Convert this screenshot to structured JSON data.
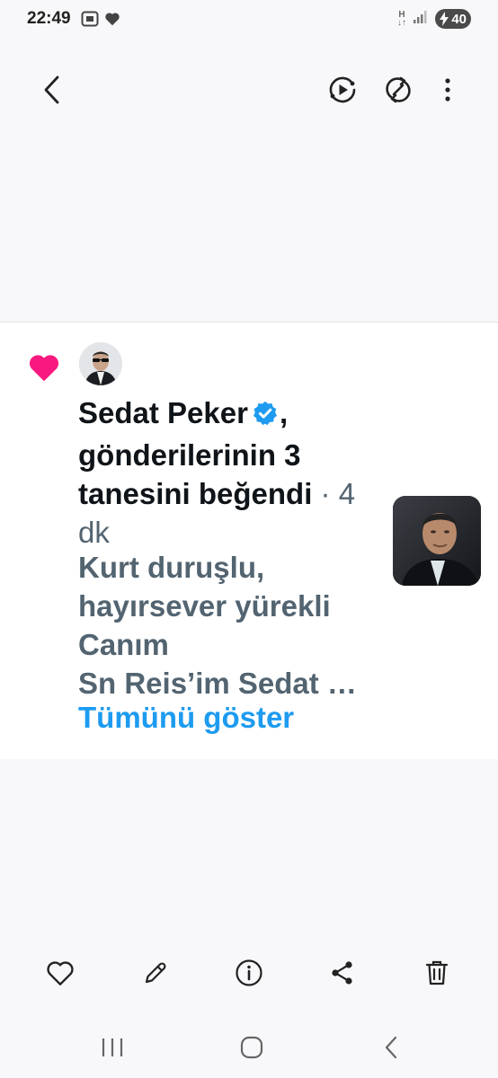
{
  "status_bar": {
    "time": "22:49",
    "network_type": "H",
    "battery_level": "40"
  },
  "toolbar": {
    "back_icon": "chevron-left-icon",
    "play_icon": "play-circle-icon",
    "sync_icon": "sync-icon",
    "more_icon": "more-vertical-icon"
  },
  "notification": {
    "badge_icon": "heart-icon",
    "user_name": "Sedat Peker",
    "verified_icon": "verified-badge-icon",
    "comma": ",",
    "action_text": "gönderilerinin 3 tanesini beğendi",
    "time_ago": " · 4 dk",
    "preview_lines": [
      "Kurt duruşlu,",
      "hayırsever yürekli",
      "Canım",
      "Sn Reis’im Sedat …"
    ],
    "show_more": "Tümünü göster",
    "colors": {
      "like": "#f91880",
      "verified": "#1d9bf0",
      "link": "#1d9bf0",
      "secondary_text": "#536471"
    }
  },
  "bottom_actions": [
    "heart-outline-icon",
    "pencil-icon",
    "info-icon",
    "share-icon",
    "trash-icon"
  ],
  "system_nav": [
    "recents-icon",
    "home-icon",
    "back-icon"
  ]
}
